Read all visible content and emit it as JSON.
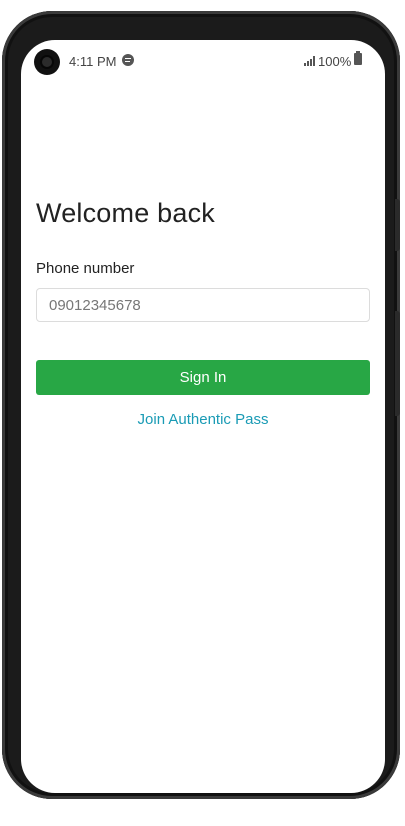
{
  "status_bar": {
    "time": "4:11 PM",
    "battery": "100%",
    "icons": [
      "camera-hole",
      "spotify-icon",
      "signal-icon",
      "battery-icon"
    ]
  },
  "login": {
    "title": "Welcome back",
    "phone_label": "Phone number",
    "phone_value": "",
    "phone_placeholder": "09012345678",
    "sign_in_label": "Sign In",
    "join_label": "Join Authentic Pass"
  },
  "colors": {
    "primary_button": "#28a745",
    "link": "#1a9bb5",
    "frame": "#1b1b1b"
  }
}
